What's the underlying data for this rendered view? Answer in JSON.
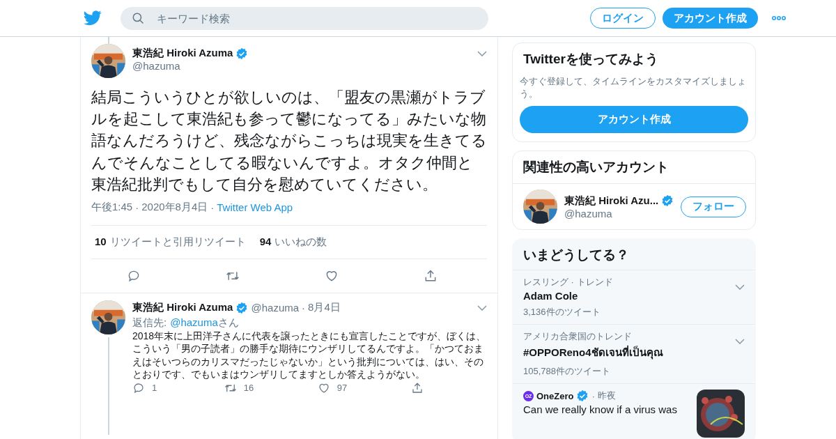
{
  "header": {
    "search_placeholder": "キーワード検索",
    "login": "ログイン",
    "signup": "アカウント作成"
  },
  "main_tweet": {
    "name": "東浩紀 Hiroki Azuma",
    "handle": "@hazuma",
    "verified": true,
    "text": "結局こういうひとが欲しいのは、「盟友の黒瀬がトラブルを起こして東浩紀も参って鬱になってる」みたいな物語なんだろうけど、残念ながらこっちは現実を生きてるんでそんなことしてる暇ないんですよ。オタク仲間と東浩紀批判でもして自分を慰めていてください。",
    "time": "午後1:45",
    "separator": "·",
    "date": "2020年8月4日",
    "source": "Twitter Web App",
    "stats": [
      {
        "count": "10",
        "label": "リツイートと引用リツイート"
      },
      {
        "count": "94",
        "label": "いいねの数"
      }
    ],
    "actions": [
      {
        "kind": "reply"
      },
      {
        "kind": "retweet"
      },
      {
        "kind": "like"
      },
      {
        "kind": "share"
      }
    ]
  },
  "reply": {
    "name": "東浩紀 Hiroki Azuma",
    "handle": "@hazuma",
    "verified": true,
    "separator": "·",
    "date": "8月4日",
    "reply_to_label": "返信先:",
    "reply_to_handle": "@hazuma",
    "reply_to_suffix": "さん",
    "text": "2018年末に上田洋子さんに代表を譲ったときにも宣言したことですが、ぼくは、こういう「男の子読者」の勝手な期待にウンザリしてるんですよ。「かつておまえはそいつらのカリスマだったじゃないか」という批判については、はい、そのとおりです、でもいまはウンザリしてますとしか答えようがない。",
    "actions": [
      {
        "kind": "reply",
        "count": "1"
      },
      {
        "kind": "retweet",
        "count": "16"
      },
      {
        "kind": "like",
        "count": "97"
      },
      {
        "kind": "share"
      }
    ]
  },
  "signup_card": {
    "title": "Twitterを使ってみよう",
    "description": "今すぐ登録して、タイムラインをカスタマイズしましょう。",
    "button": "アカウント作成"
  },
  "related": {
    "title": "関連性の高いアカウント",
    "accounts": [
      {
        "name": "東浩紀 Hiroki Azu...",
        "handle": "@hazuma",
        "verified": true,
        "follow": "フォロー"
      }
    ]
  },
  "trends": {
    "title": "いまどうしてる？",
    "items": [
      {
        "kind": "trend",
        "context": "レスリング · トレンド",
        "name": "Adam Cole",
        "count": "3,136件のツイート"
      },
      {
        "kind": "trend",
        "context": "アメリカ合衆国のトレンド",
        "name": "#OPPOReno4ชัดเจนที่เป็นคุณ",
        "count": "105,788件のツイート"
      },
      {
        "kind": "news",
        "source_logo": "OZ",
        "source": "OneZero",
        "verified": true,
        "separator": "·",
        "time": "昨夜",
        "headline": "Can we really know if a virus was"
      }
    ]
  }
}
